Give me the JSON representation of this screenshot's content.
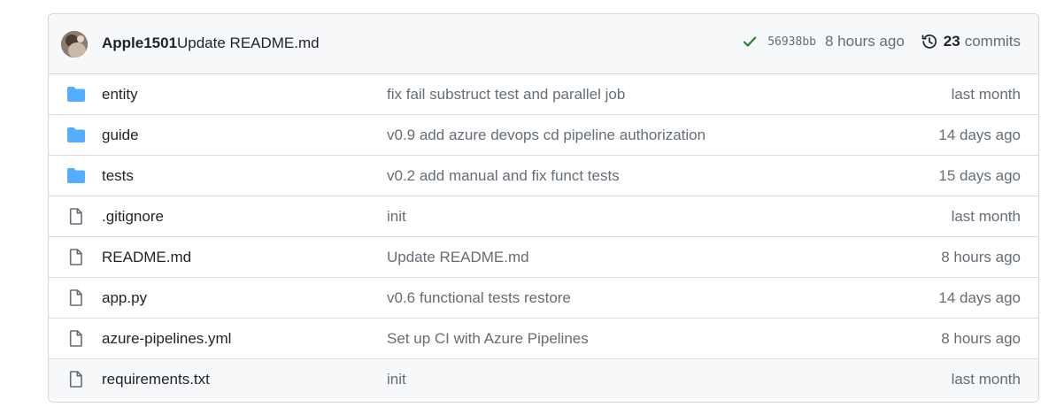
{
  "latest_commit": {
    "author": "Apple1501",
    "message": "Update README.md",
    "sha": "56938bb",
    "time_ago": "8 hours ago",
    "commit_count": "23",
    "commits_label": "commits",
    "status_color": "#1a7f37"
  },
  "colors": {
    "folder": "#54aeff",
    "file": "#656d76",
    "border": "#d0d7de",
    "header_bg": "#f6f8fa"
  },
  "files": [
    {
      "type": "folder",
      "icon": "folder-icon",
      "name": "entity",
      "message": "fix fail substruct test and parallel job",
      "time": "last month"
    },
    {
      "type": "folder",
      "icon": "folder-icon",
      "name": "guide",
      "message": "v0.9 add azure devops cd pipeline authorization",
      "time": "14 days ago"
    },
    {
      "type": "folder",
      "icon": "folder-icon",
      "name": "tests",
      "message": "v0.2 add manual and fix funct tests",
      "time": "15 days ago"
    },
    {
      "type": "file",
      "icon": "file-icon",
      "name": ".gitignore",
      "message": "init",
      "time": "last month"
    },
    {
      "type": "file",
      "icon": "file-icon",
      "name": "README.md",
      "message": "Update README.md",
      "time": "8 hours ago"
    },
    {
      "type": "file",
      "icon": "file-icon",
      "name": "app.py",
      "message": "v0.6 functional tests restore",
      "time": "14 days ago"
    },
    {
      "type": "file",
      "icon": "file-icon",
      "name": "azure-pipelines.yml",
      "message": "Set up CI with Azure Pipelines",
      "time": "8 hours ago"
    },
    {
      "type": "file",
      "icon": "file-icon",
      "name": "requirements.txt",
      "message": "init",
      "time": "last month"
    }
  ]
}
